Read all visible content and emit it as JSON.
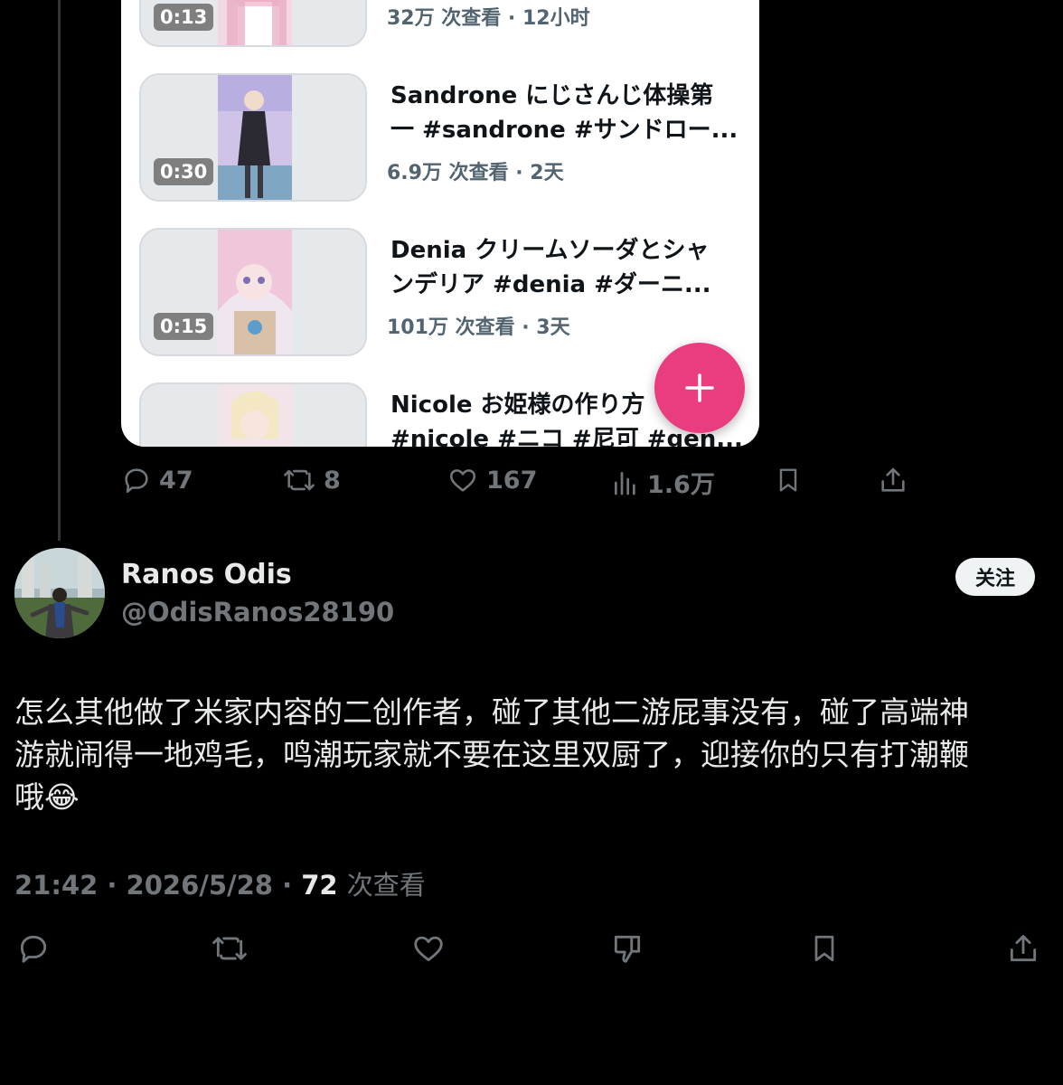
{
  "videos": [
    {
      "duration": "0:13",
      "title_lines": [],
      "meta": "32万 次查看 · 12小时"
    },
    {
      "duration": "0:30",
      "title_lines": [
        "Sandrone にじさんじ体操第",
        "一 #sandrone #サンドロー..."
      ],
      "meta": "6.9万 次查看 · 2天"
    },
    {
      "duration": "0:15",
      "title_lines": [
        "Denia クリームソーダとシャ",
        "ンデリア #denia #ダーニ..."
      ],
      "meta": "101万 次查看 · 3天"
    },
    {
      "duration": "",
      "title_lines": [
        "Nicole お姫様の作り方",
        "#nicole #ニコ #尼可 #gen..."
      ],
      "meta": ""
    }
  ],
  "fab": {
    "icon": "plus-icon"
  },
  "parent_actions": {
    "replies": "47",
    "reposts": "8",
    "likes": "167",
    "views": "1.6万"
  },
  "reply": {
    "display_name": "Ranos Odis",
    "handle": "@OdisRanos28190",
    "follow_label": "关注",
    "text": "怎么其他做了米家内容的二创作者，碰了其他二游屁事没有，碰了高端神\n游就闹得一地鸡毛，鸣潮玩家就不要在这里双厨了，迎接你的只有打潮鞭\n哦😂",
    "time": "21:42",
    "date": "2026/5/28",
    "views": "72",
    "views_label": "次查看"
  },
  "colors": {
    "background": "#000000",
    "text_primary": "#e7e9ea",
    "text_secondary": "#71767b",
    "fab": "#ea3d80"
  }
}
